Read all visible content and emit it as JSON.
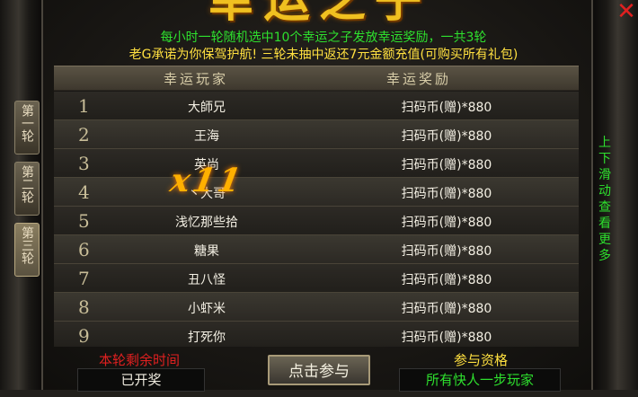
{
  "title": "幸运之子",
  "close_icon": "✕",
  "info": {
    "line1": "每小时一轮随机选中10个幸运之子发放幸运奖励，一共3轮",
    "line2": "老G承诺为你保驾护航! 三轮未抽中返还7元金额充值(可购买所有礼包)"
  },
  "header": {
    "player": "幸运玩家",
    "reward": "幸运奖励"
  },
  "rounds": [
    {
      "label": "第一轮"
    },
    {
      "label": "第二轮"
    },
    {
      "label": "第三轮"
    }
  ],
  "rows": [
    {
      "idx": "1",
      "name": "大師兄",
      "reward": "扫码币(赠)*880"
    },
    {
      "idx": "2",
      "name": "王海",
      "reward": "扫码币(赠)*880"
    },
    {
      "idx": "3",
      "name": "英尚",
      "reward": "扫码币(赠)*880"
    },
    {
      "idx": "4",
      "name": "丶大哥",
      "reward": "扫码币(赠)*880"
    },
    {
      "idx": "5",
      "name": "浅忆那些拾",
      "reward": "扫码币(赠)*880"
    },
    {
      "idx": "6",
      "name": "糖果",
      "reward": "扫码币(赠)*880"
    },
    {
      "idx": "7",
      "name": "丑八怪",
      "reward": "扫码币(赠)*880"
    },
    {
      "idx": "8",
      "name": "小虾米",
      "reward": "扫码币(赠)*880"
    },
    {
      "idx": "9",
      "name": "打死你",
      "reward": "扫码币(赠)*880"
    }
  ],
  "multiplier": "x11",
  "scroll_hint": "上下滑动查看更多",
  "bottom": {
    "timer_label": "本轮剩余时间",
    "timer_value": "已开奖",
    "join_button": "点击参与",
    "elig_label": "参与资格",
    "elig_value": "所有快人一步玩家"
  },
  "colors": {
    "green": "#2ee02e",
    "yellow": "#ffe040",
    "red": "#e02020",
    "gold": "#f0c020"
  }
}
